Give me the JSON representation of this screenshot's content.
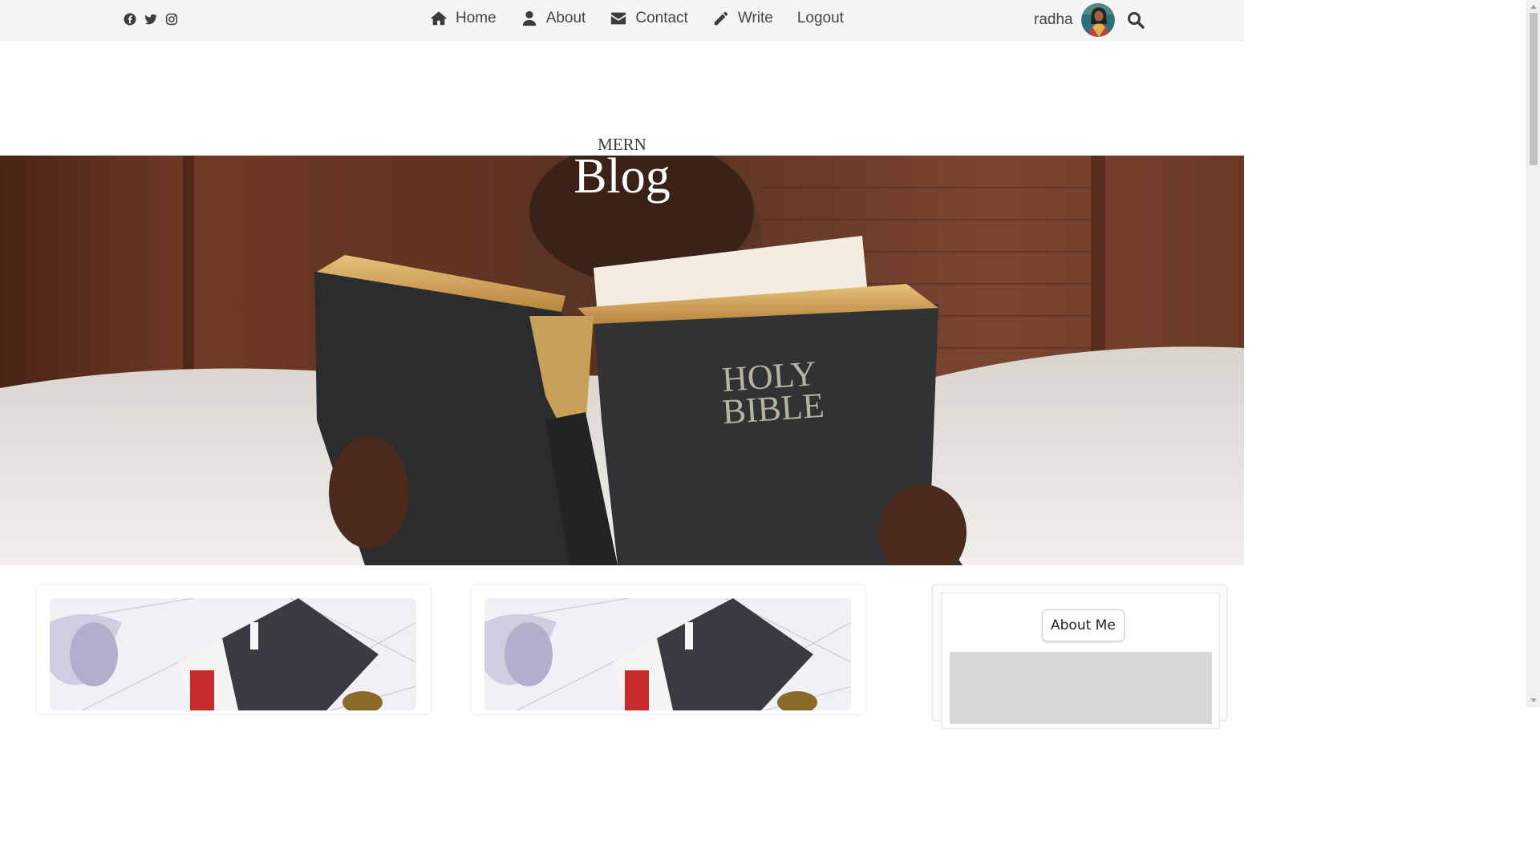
{
  "nav": {
    "social": [
      {
        "icon": "facebook-icon"
      },
      {
        "icon": "twitter-icon"
      },
      {
        "icon": "instagram-icon"
      }
    ],
    "items": [
      {
        "label": "Home",
        "icon": "home-icon"
      },
      {
        "label": "About",
        "icon": "user-icon"
      },
      {
        "label": "Contact",
        "icon": "envelope-icon"
      },
      {
        "label": "Write",
        "icon": "pencil-icon"
      },
      {
        "label": "Logout"
      }
    ],
    "user": {
      "name": "radha",
      "icon": "search-icon"
    }
  },
  "header": {
    "title_small": "MERN",
    "title_large": "Blog",
    "hero_alt": "Child reading a Holy Bible",
    "hero_book_text": [
      "HOLY",
      "BIBLE"
    ]
  },
  "sidebar": {
    "title": "About Me"
  },
  "colors": {
    "topbar": "#f5f5f5",
    "text": "#444444",
    "hero_wood": "#6b3a26",
    "bible_cover": "#2d2f31"
  }
}
